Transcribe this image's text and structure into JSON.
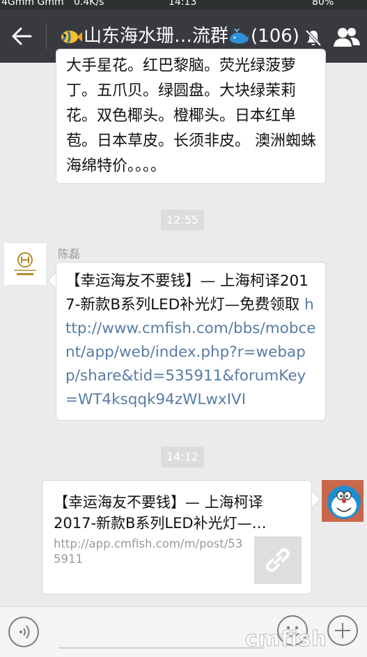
{
  "status_bar": {
    "network": "4Gmm Gmm",
    "speed": "0.4K/s",
    "time": "14:13",
    "battery": "80%"
  },
  "header": {
    "title": "山东海水珊…流群",
    "member_count": "(106)",
    "icons": [
      "back-arrow-icon",
      "fish-icon",
      "whale-icon",
      "mute-bell-icon",
      "group-members-icon"
    ]
  },
  "messages": [
    {
      "type": "text",
      "text": "大手星花。红巴黎脑。荧光绿菠萝丁。五爪贝。绿圆盘。大块绿茉莉花。双色椰头。橙椰头。日本红单苞。日本草皮。长须非皮。 澳洲蜘蛛海绵特价。。。。"
    },
    {
      "type": "timestamp",
      "text": "12:55"
    },
    {
      "type": "text",
      "sender": "陈磊",
      "text_prefix": "【幸运海友不要钱】— 上海柯译2017-新款B系列LED补光灯—免费领取 ",
      "link": "http://www.cmfish.com/bbs/mobcent/app/web/index.php?r=webapp/share&tid=535911&forumKey=WT4ksqqk94zWLwxIVI"
    },
    {
      "type": "timestamp",
      "text": "14:12"
    },
    {
      "type": "link_card",
      "title": "【幸运海友不要钱】— 上海柯译2017-新款B系列LED补光灯—…",
      "url": "http://app.cmfish.com/m/post/535911"
    }
  ],
  "watermark": "cmfish",
  "colors": {
    "title_bar": "#393a3f",
    "chat_bg": "#ebebeb",
    "link": "#587ca5"
  }
}
